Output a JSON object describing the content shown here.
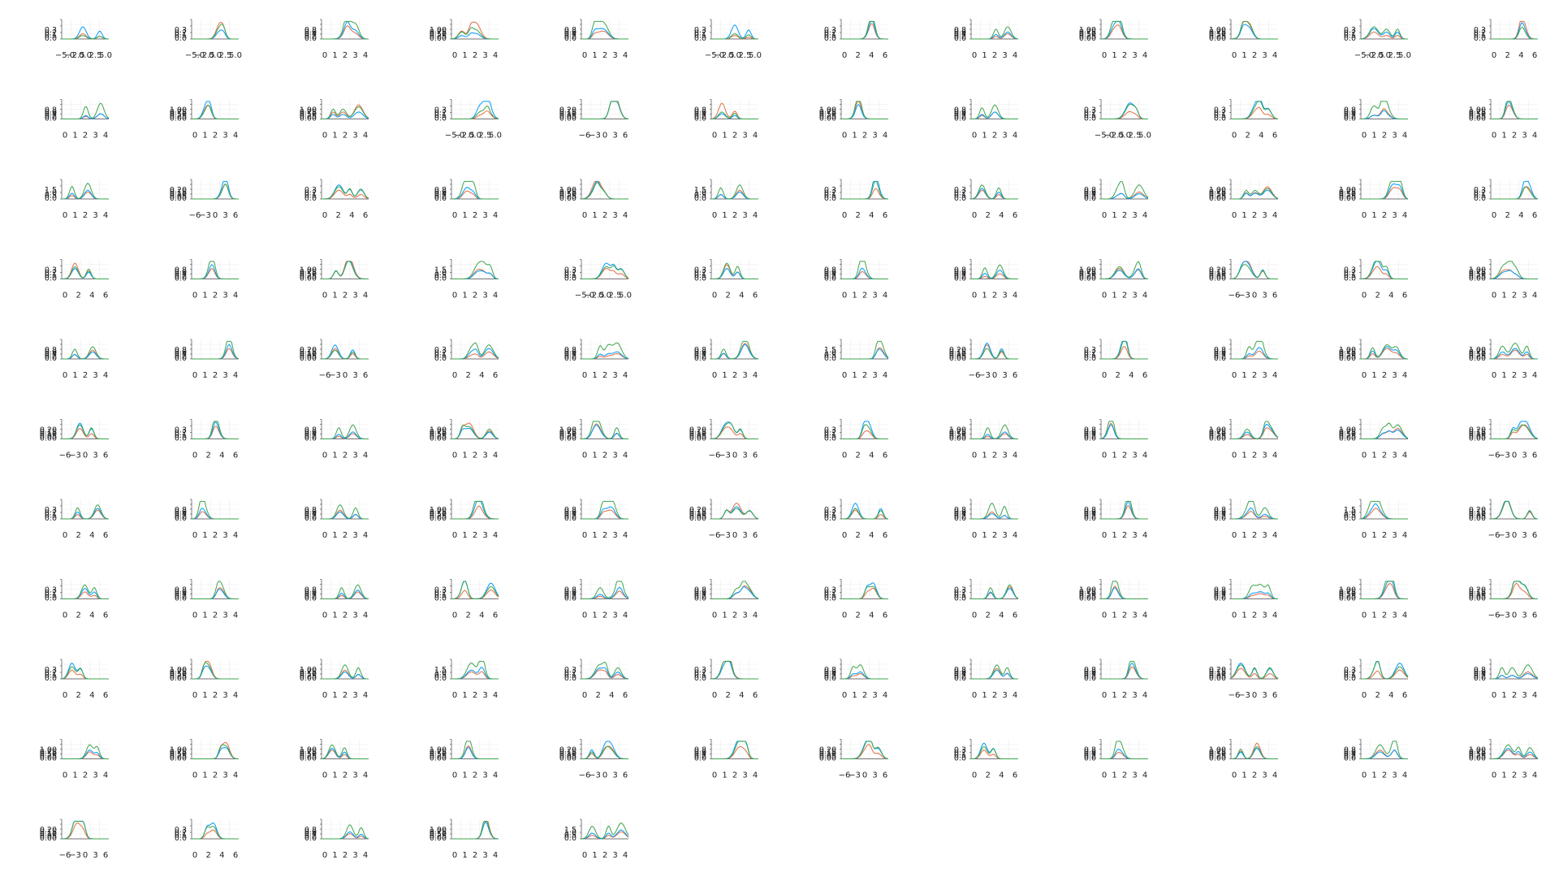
{
  "figure": {
    "background": "#ffffff",
    "panel_count": 125,
    "columns": 12,
    "line_colors": [
      "#e26f46",
      "#009afa",
      "#3da44d"
    ]
  },
  "chart_data": {
    "type": "line",
    "note_panels_small_multiples": true,
    "templates": {
      "A": {
        "x_ticks": [
          "0",
          "1",
          "2",
          "3",
          "4"
        ],
        "y_ticks": [
          "0.0",
          "0.2",
          "0.4",
          "0.6",
          "0.8"
        ],
        "xlim": [
          -0.3,
          4.5
        ],
        "ylim": [
          0,
          0.9
        ]
      },
      "B": {
        "x_ticks": [
          "0",
          "2",
          "4",
          "6"
        ],
        "y_ticks": [
          "0.0",
          "0.1",
          "0.2",
          "0.3"
        ],
        "xlim": [
          -1,
          7
        ],
        "ylim": [
          0,
          0.35
        ]
      },
      "C": {
        "x_ticks": [
          "−5.0",
          "−2.5",
          "0.0",
          "2.5",
          "5.0"
        ],
        "y_ticks": [
          "0.0",
          "0.1",
          "0.2",
          "0.3"
        ],
        "xlim": [
          -6,
          6
        ],
        "ylim": [
          0,
          0.35
        ]
      },
      "D": {
        "x_ticks": [
          "−6",
          "−3",
          "0",
          "3",
          "6"
        ],
        "y_ticks": [
          "0.00",
          "0.05",
          "0.10",
          "0.15",
          "0.20"
        ],
        "xlim": [
          -7,
          7
        ],
        "ylim": [
          0,
          0.22
        ]
      },
      "E": {
        "x_ticks": [
          "0",
          "1",
          "2",
          "3",
          "4"
        ],
        "y_ticks": [
          "0.00",
          "0.25",
          "0.50",
          "0.75",
          "1.00"
        ],
        "xlim": [
          -0.3,
          4.5
        ],
        "ylim": [
          0,
          1.1
        ]
      },
      "F": {
        "x_ticks": [
          "0",
          "1",
          "2",
          "3",
          "4"
        ],
        "y_ticks": [
          "0.0",
          "0.5",
          "1.0",
          "1.5"
        ],
        "xlim": [
          -0.3,
          4.5
        ],
        "ylim": [
          0,
          1.6
        ]
      }
    },
    "panels": [
      {
        "t": "C",
        "s": [
          0.3,
          0.7,
          0.2
        ]
      },
      {
        "t": "C",
        "s": [
          0.8,
          0.4,
          0.6
        ]
      },
      {
        "t": "A",
        "s": [
          0.5,
          0.6,
          0.9
        ]
      },
      {
        "t": "E",
        "s": [
          0.9,
          0.3,
          0.5
        ]
      },
      {
        "t": "A",
        "s": [
          0.4,
          0.5,
          0.8
        ]
      },
      {
        "t": "C",
        "s": [
          0.2,
          0.8,
          0.3
        ]
      },
      {
        "t": "B",
        "s": [
          0.6,
          0.7,
          0.9
        ]
      },
      {
        "t": "A",
        "s": [
          0.3,
          0.4,
          0.7
        ]
      },
      {
        "t": "E",
        "s": [
          0.5,
          0.6,
          0.8
        ]
      },
      {
        "t": "E",
        "s": [
          0.7,
          0.5,
          0.6
        ]
      },
      {
        "t": "C",
        "s": [
          0.4,
          0.6,
          0.7
        ]
      },
      {
        "t": "B",
        "s": [
          0.9,
          0.6,
          0.4
        ]
      },
      {
        "t": "A",
        "s": [
          0.3,
          0.3,
          0.9
        ]
      },
      {
        "t": "E",
        "s": [
          0.6,
          0.8,
          0.5
        ]
      },
      {
        "t": "E",
        "s": [
          0.8,
          0.4,
          0.7
        ]
      },
      {
        "t": "C",
        "s": [
          0.3,
          0.9,
          0.4
        ]
      },
      {
        "t": "D",
        "s": [
          0.8,
          0.7,
          0.6
        ]
      },
      {
        "t": "A",
        "s": [
          0.9,
          0.3,
          0.4
        ]
      },
      {
        "t": "E",
        "s": [
          0.7,
          0.5,
          0.8
        ]
      },
      {
        "t": "A",
        "s": [
          0.4,
          0.4,
          0.8
        ]
      },
      {
        "t": "C",
        "s": [
          0.3,
          0.6,
          0.5
        ]
      },
      {
        "t": "B",
        "s": [
          0.5,
          0.9,
          0.7
        ]
      },
      {
        "t": "A",
        "s": [
          0.4,
          0.3,
          0.9
        ]
      },
      {
        "t": "E",
        "s": [
          0.6,
          0.7,
          0.8
        ]
      },
      {
        "t": "F",
        "s": [
          0.4,
          0.5,
          0.9
        ]
      },
      {
        "t": "D",
        "s": [
          0.6,
          0.8,
          0.5
        ]
      },
      {
        "t": "B",
        "s": [
          0.5,
          0.8,
          0.7
        ]
      },
      {
        "t": "A",
        "s": [
          0.3,
          0.4,
          0.8
        ]
      },
      {
        "t": "E",
        "s": [
          0.8,
          0.6,
          0.5
        ]
      },
      {
        "t": "F",
        "s": [
          0.5,
          0.4,
          0.8
        ]
      },
      {
        "t": "B",
        "s": [
          0.4,
          0.9,
          0.6
        ]
      },
      {
        "t": "B",
        "s": [
          0.5,
          0.6,
          0.8
        ]
      },
      {
        "t": "A",
        "s": [
          0.4,
          0.3,
          0.8
        ]
      },
      {
        "t": "E",
        "s": [
          0.7,
          0.5,
          0.6
        ]
      },
      {
        "t": "E",
        "s": [
          0.5,
          0.6,
          0.8
        ]
      },
      {
        "t": "B",
        "s": [
          0.6,
          0.9,
          0.5
        ]
      },
      {
        "t": "B",
        "s": [
          0.9,
          0.6,
          0.7
        ]
      },
      {
        "t": "A",
        "s": [
          0.4,
          0.5,
          0.8
        ]
      },
      {
        "t": "E",
        "s": [
          0.9,
          0.7,
          0.6
        ]
      },
      {
        "t": "F",
        "s": [
          0.5,
          0.4,
          0.8
        ]
      },
      {
        "t": "C",
        "s": [
          0.6,
          0.9,
          0.7
        ]
      },
      {
        "t": "B",
        "s": [
          0.8,
          0.6,
          0.9
        ]
      },
      {
        "t": "A",
        "s": [
          0.3,
          0.4,
          0.9
        ]
      },
      {
        "t": "A",
        "s": [
          0.3,
          0.5,
          0.8
        ]
      },
      {
        "t": "E",
        "s": [
          0.6,
          0.5,
          0.7
        ]
      },
      {
        "t": "D",
        "s": [
          0.9,
          0.8,
          0.6
        ]
      },
      {
        "t": "B",
        "s": [
          0.5,
          0.7,
          0.8
        ]
      },
      {
        "t": "E",
        "s": [
          0.5,
          0.4,
          0.8
        ]
      },
      {
        "t": "A",
        "s": [
          0.5,
          0.4,
          0.7
        ]
      },
      {
        "t": "A",
        "s": [
          0.4,
          0.5,
          0.8
        ]
      },
      {
        "t": "D",
        "s": [
          0.6,
          0.8,
          0.5
        ]
      },
      {
        "t": "B",
        "s": [
          0.4,
          0.6,
          0.8
        ]
      },
      {
        "t": "A",
        "s": [
          0.3,
          0.4,
          0.9
        ]
      },
      {
        "t": "A",
        "s": [
          0.6,
          0.5,
          0.7
        ]
      },
      {
        "t": "F",
        "s": [
          0.5,
          0.4,
          0.8
        ]
      },
      {
        "t": "D",
        "s": [
          0.8,
          0.9,
          0.6
        ]
      },
      {
        "t": "B",
        "s": [
          0.5,
          0.9,
          0.7
        ]
      },
      {
        "t": "A",
        "s": [
          0.3,
          0.4,
          0.8
        ]
      },
      {
        "t": "E",
        "s": [
          0.6,
          0.7,
          0.8
        ]
      },
      {
        "t": "E",
        "s": [
          0.5,
          0.6,
          0.9
        ]
      },
      {
        "t": "D",
        "s": [
          0.6,
          0.9,
          0.8
        ]
      },
      {
        "t": "B",
        "s": [
          0.5,
          0.6,
          0.8
        ]
      },
      {
        "t": "A",
        "s": [
          0.3,
          0.4,
          0.8
        ]
      },
      {
        "t": "E",
        "s": [
          0.9,
          0.6,
          0.7
        ]
      },
      {
        "t": "E",
        "s": [
          0.6,
          0.5,
          0.8
        ]
      },
      {
        "t": "D",
        "s": [
          0.6,
          0.8,
          0.7
        ]
      },
      {
        "t": "B",
        "s": [
          0.4,
          0.9,
          0.6
        ]
      },
      {
        "t": "E",
        "s": [
          0.3,
          0.4,
          0.8
        ]
      },
      {
        "t": "A",
        "s": [
          0.6,
          0.5,
          0.8
        ]
      },
      {
        "t": "E",
        "s": [
          0.5,
          0.6,
          0.7
        ]
      },
      {
        "t": "E",
        "s": [
          0.6,
          0.5,
          0.8
        ]
      },
      {
        "t": "D",
        "s": [
          0.7,
          0.9,
          0.6
        ]
      },
      {
        "t": "B",
        "s": [
          0.5,
          0.6,
          0.8
        ]
      },
      {
        "t": "A",
        "s": [
          0.3,
          0.4,
          0.8
        ]
      },
      {
        "t": "A",
        "s": [
          0.5,
          0.4,
          0.8
        ]
      },
      {
        "t": "E",
        "s": [
          0.4,
          0.6,
          0.8
        ]
      },
      {
        "t": "A",
        "s": [
          0.4,
          0.5,
          0.8
        ]
      },
      {
        "t": "D",
        "s": [
          0.9,
          0.7,
          0.6
        ]
      },
      {
        "t": "B",
        "s": [
          0.5,
          0.9,
          0.6
        ]
      },
      {
        "t": "A",
        "s": [
          0.4,
          0.3,
          0.9
        ]
      },
      {
        "t": "A",
        "s": [
          0.5,
          0.6,
          0.8
        ]
      },
      {
        "t": "A",
        "s": [
          0.3,
          0.4,
          0.8
        ]
      },
      {
        "t": "F",
        "s": [
          0.4,
          0.5,
          0.9
        ]
      },
      {
        "t": "D",
        "s": [
          0.8,
          0.7,
          0.6
        ]
      },
      {
        "t": "B",
        "s": [
          0.4,
          0.6,
          0.8
        ]
      },
      {
        "t": "A",
        "s": [
          0.5,
          0.4,
          0.7
        ]
      },
      {
        "t": "A",
        "s": [
          0.4,
          0.5,
          0.8
        ]
      },
      {
        "t": "B",
        "s": [
          0.5,
          0.9,
          0.7
        ]
      },
      {
        "t": "A",
        "s": [
          0.3,
          0.4,
          0.8
        ]
      },
      {
        "t": "A",
        "s": [
          0.6,
          0.5,
          0.7
        ]
      },
      {
        "t": "B",
        "s": [
          0.6,
          0.9,
          0.7
        ]
      },
      {
        "t": "B",
        "s": [
          0.7,
          0.6,
          0.8
        ]
      },
      {
        "t": "E",
        "s": [
          0.5,
          0.4,
          0.8
        ]
      },
      {
        "t": "A",
        "s": [
          0.3,
          0.4,
          0.8
        ]
      },
      {
        "t": "E",
        "s": [
          0.5,
          0.6,
          0.8
        ]
      },
      {
        "t": "D",
        "s": [
          0.6,
          0.9,
          0.8
        ]
      },
      {
        "t": "B",
        "s": [
          0.5,
          0.9,
          0.7
        ]
      },
      {
        "t": "E",
        "s": [
          0.9,
          0.6,
          0.7
        ]
      },
      {
        "t": "E",
        "s": [
          0.5,
          0.4,
          0.8
        ]
      },
      {
        "t": "F",
        "s": [
          0.4,
          0.5,
          0.9
        ]
      },
      {
        "t": "B",
        "s": [
          0.5,
          0.6,
          0.8
        ]
      },
      {
        "t": "B",
        "s": [
          0.9,
          0.6,
          0.7
        ]
      },
      {
        "t": "A",
        "s": [
          0.3,
          0.4,
          0.8
        ]
      },
      {
        "t": "A",
        "s": [
          0.6,
          0.5,
          0.8
        ]
      },
      {
        "t": "A",
        "s": [
          0.5,
          0.6,
          0.8
        ]
      },
      {
        "t": "D",
        "s": [
          0.6,
          0.9,
          0.8
        ]
      },
      {
        "t": "B",
        "s": [
          0.5,
          0.9,
          0.7
        ]
      },
      {
        "t": "A",
        "s": [
          0.4,
          0.3,
          0.8
        ]
      },
      {
        "t": "E",
        "s": [
          0.4,
          0.5,
          0.8
        ]
      },
      {
        "t": "E",
        "s": [
          0.9,
          0.6,
          0.7
        ]
      },
      {
        "t": "E",
        "s": [
          0.5,
          0.6,
          0.8
        ]
      },
      {
        "t": "E",
        "s": [
          0.5,
          0.4,
          0.8
        ]
      },
      {
        "t": "D",
        "s": [
          0.6,
          0.8,
          0.5
        ]
      },
      {
        "t": "A",
        "s": [
          0.5,
          0.9,
          0.7
        ]
      },
      {
        "t": "D",
        "s": [
          0.6,
          0.9,
          0.8
        ]
      },
      {
        "t": "B",
        "s": [
          0.5,
          0.9,
          0.7
        ]
      },
      {
        "t": "A",
        "s": [
          0.3,
          0.4,
          0.8
        ]
      },
      {
        "t": "E",
        "s": [
          0.9,
          0.6,
          0.7
        ]
      },
      {
        "t": "A",
        "s": [
          0.5,
          0.4,
          0.8
        ]
      },
      {
        "t": "E",
        "s": [
          0.5,
          0.6,
          0.8
        ]
      },
      {
        "t": "D",
        "s": [
          0.6,
          0.9,
          0.8
        ]
      },
      {
        "t": "B",
        "s": [
          0.5,
          0.9,
          0.7
        ]
      },
      {
        "t": "A",
        "s": [
          0.3,
          0.4,
          0.8
        ]
      },
      {
        "t": "E",
        "s": [
          0.9,
          0.6,
          0.7
        ]
      },
      {
        "t": "F",
        "s": [
          0.4,
          0.5,
          0.9
        ]
      }
    ]
  }
}
